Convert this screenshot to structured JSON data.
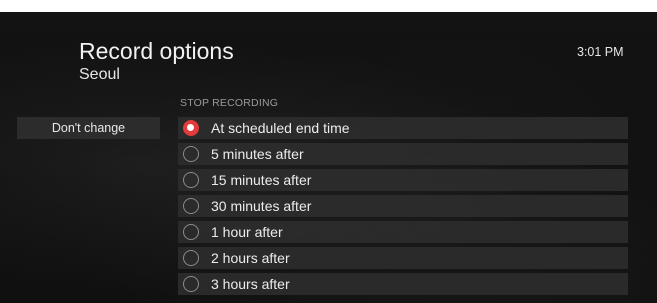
{
  "header": {
    "title": "Record options",
    "subtitle": "Seoul",
    "time": "3:01 PM"
  },
  "section": {
    "label": "STOP RECORDING"
  },
  "side_button": {
    "label": "Don't change"
  },
  "options": [
    {
      "label": "At scheduled end time",
      "selected": true
    },
    {
      "label": "5 minutes after",
      "selected": false
    },
    {
      "label": "15 minutes after",
      "selected": false
    },
    {
      "label": "30 minutes after",
      "selected": false
    },
    {
      "label": "1 hour after",
      "selected": false
    },
    {
      "label": "2 hours after",
      "selected": false
    },
    {
      "label": "3 hours after",
      "selected": false
    }
  ],
  "colors": {
    "accent": "#e23b3b",
    "row_background": "#2c2c2c"
  }
}
